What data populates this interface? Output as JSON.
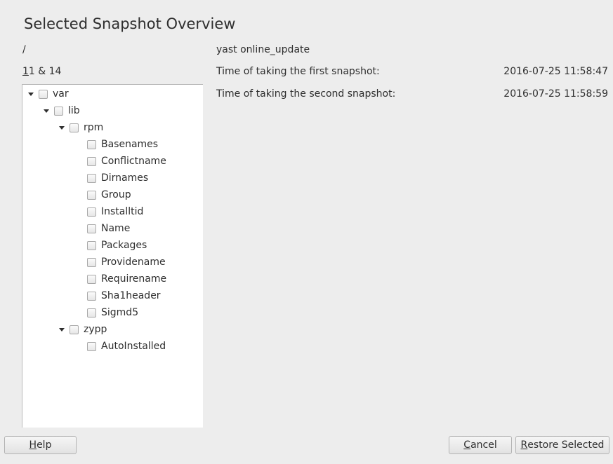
{
  "window": {
    "title": "Selected Snapshot Overview"
  },
  "path": "/",
  "snapshots": {
    "first_digit": "1",
    "rest": "1 & 14"
  },
  "description": "yast online_update",
  "info": [
    {
      "label": "Time of taking the first snapshot:",
      "value": "2016-07-25 11:58:47"
    },
    {
      "label": "Time of taking the second snapshot:",
      "value": "2016-07-25 11:58:59"
    }
  ],
  "tree": {
    "var": "var",
    "lib": "lib",
    "rpm": "rpm",
    "rpm_files": [
      "Basenames",
      "Conflictname",
      "Dirnames",
      "Group",
      "Installtid",
      "Name",
      "Packages",
      "Providename",
      "Requirename",
      "Sha1header",
      "Sigmd5"
    ],
    "zypp": "zypp",
    "zypp_files": [
      "AutoInstalled"
    ]
  },
  "buttons": {
    "help_mnemonic": "H",
    "help_rest": "elp",
    "cancel_mnemonic": "C",
    "cancel_rest": "ancel",
    "restore_mnemonic": "R",
    "restore_rest": "estore Selected"
  }
}
